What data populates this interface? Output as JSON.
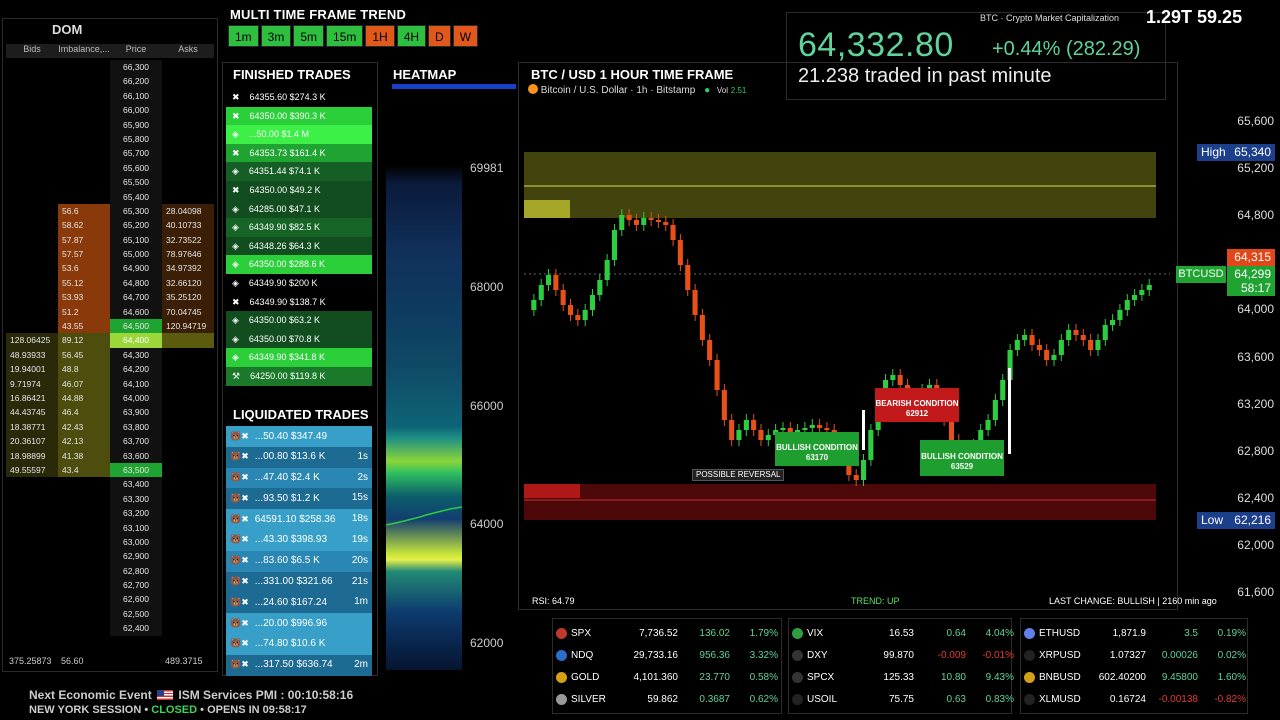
{
  "dom": {
    "title": "DOM",
    "headers": [
      "Bids",
      "Imbalance,...",
      "Price",
      "Asks"
    ],
    "rows": [
      [
        "",
        "",
        "66,300",
        ""
      ],
      [
        "",
        "",
        "66,200",
        ""
      ],
      [
        "",
        "",
        "66,100",
        ""
      ],
      [
        "",
        "",
        "66,000",
        ""
      ],
      [
        "",
        "",
        "65,900",
        ""
      ],
      [
        "",
        "",
        "65,800",
        ""
      ],
      [
        "",
        "",
        "65,700",
        ""
      ],
      [
        "",
        "",
        "65,600",
        ""
      ],
      [
        "",
        "",
        "65,500",
        ""
      ],
      [
        "",
        "",
        "65,400",
        ""
      ],
      [
        "",
        "56.6",
        "65,300",
        "28.04098"
      ],
      [
        "",
        "58.62",
        "65,200",
        "40.10733"
      ],
      [
        "",
        "57.87",
        "65,100",
        "32.73522"
      ],
      [
        "",
        "57.57",
        "65,000",
        "78.97646"
      ],
      [
        "",
        "53.6",
        "64,900",
        "34.97392"
      ],
      [
        "",
        "55.12",
        "64,800",
        "32.66120"
      ],
      [
        "",
        "53.93",
        "64,700",
        "35.25120"
      ],
      [
        "",
        "51.2",
        "64,600",
        "70.04745"
      ],
      [
        "",
        "43.55",
        "64,500",
        "120.94719"
      ],
      [
        "128.06425",
        "89.12",
        "64,400",
        ""
      ],
      [
        "48.93933",
        "56.45",
        "64,300",
        ""
      ],
      [
        "19.94001",
        "48.8",
        "64,200",
        ""
      ],
      [
        "9.71974",
        "46.07",
        "64,100",
        ""
      ],
      [
        "16.86421",
        "44.88",
        "64,000",
        ""
      ],
      [
        "44.43745",
        "46.4",
        "63,900",
        ""
      ],
      [
        "18.38771",
        "42.43",
        "63,800",
        ""
      ],
      [
        "20.36107",
        "42.13",
        "63,700",
        ""
      ],
      [
        "18.98899",
        "41.38",
        "63,600",
        ""
      ],
      [
        "49.55597",
        "43.4",
        "63,500",
        ""
      ],
      [
        "",
        "",
        "63,400",
        ""
      ],
      [
        "",
        "",
        "63,300",
        ""
      ],
      [
        "",
        "",
        "63,200",
        ""
      ],
      [
        "",
        "",
        "63,100",
        ""
      ],
      [
        "",
        "",
        "63,000",
        ""
      ],
      [
        "",
        "",
        "62,900",
        ""
      ],
      [
        "",
        "",
        "62,800",
        ""
      ],
      [
        "",
        "",
        "62,700",
        ""
      ],
      [
        "",
        "",
        "62,600",
        ""
      ],
      [
        "",
        "",
        "62,500",
        ""
      ],
      [
        "",
        "",
        "62,400",
        ""
      ]
    ],
    "footer": [
      "375.25873",
      "56.60",
      "",
      "489.3715"
    ]
  },
  "mtf": {
    "title": "MULTI TIME FRAME TREND",
    "frames": [
      {
        "label": "1m",
        "color": "#2fbf3f"
      },
      {
        "label": "3m",
        "color": "#2fbf3f"
      },
      {
        "label": "5m",
        "color": "#2fbf3f"
      },
      {
        "label": "15m",
        "color": "#2fbf3f"
      },
      {
        "label": "1H",
        "color": "#e0581a"
      },
      {
        "label": "4H",
        "color": "#2fbf3f"
      },
      {
        "label": "D",
        "color": "#e0581a"
      },
      {
        "label": "W",
        "color": "#e0581a"
      }
    ]
  },
  "finished": {
    "title": "FINISHED TRADES",
    "rows": [
      {
        "icon": "✖",
        "text": "64355.60 $274.3 K",
        "bg": "#000"
      },
      {
        "icon": "✖",
        "text": "64350.00 $390.3 K",
        "bg": "#2bcf3a"
      },
      {
        "icon": "◈",
        "text": "...50.00 $1.4 M",
        "bg": "#3df048"
      },
      {
        "icon": "✖",
        "text": "64353.73 $161.4 K",
        "bg": "#1fa331"
      },
      {
        "icon": "◈",
        "text": "64351.44 $74.1 K",
        "bg": "#155e26"
      },
      {
        "icon": "✖",
        "text": "64350.00 $49.2 K",
        "bg": "#124d20"
      },
      {
        "icon": "◈",
        "text": "64285.00 $47.1 K",
        "bg": "#124d20"
      },
      {
        "icon": "◈",
        "text": "64349.90 $82.5 K",
        "bg": "#166426"
      },
      {
        "icon": "◈",
        "text": "64348.26 $64.3 K",
        "bg": "#124d20"
      },
      {
        "icon": "◈",
        "text": "64350.00 $288.6 K",
        "bg": "#2bcf3a"
      },
      {
        "icon": "◈",
        "text": "64349.90 $200 K",
        "bg": "#000"
      },
      {
        "icon": "✖",
        "text": "64349.90 $138.7 K",
        "bg": "#000"
      },
      {
        "icon": "◈",
        "text": "64350.00 $63.2 K",
        "bg": "#124d20"
      },
      {
        "icon": "◈",
        "text": "64350.00 $70.8 K",
        "bg": "#124d20"
      },
      {
        "icon": "◈",
        "text": "64349.90 $341.8 K",
        "bg": "#2bcf3a"
      },
      {
        "icon": "⚒",
        "text": "64250.00 $119.8 K",
        "bg": "#1a7a2a"
      }
    ]
  },
  "liquidated": {
    "title": "LIQUIDATED TRADES",
    "rows": [
      {
        "text": "...50.40 $347.49",
        "time": ""
      },
      {
        "text": "...00.80 $13.6 K",
        "time": "1s"
      },
      {
        "text": "...47.40 $2.4 K",
        "time": "2s"
      },
      {
        "text": "...93.50 $1.2 K",
        "time": "15s"
      },
      {
        "text": "64591.10 $258.36",
        "time": "18s"
      },
      {
        "text": "...43.30 $398.93",
        "time": "19s"
      },
      {
        "text": "...83.60 $6.5 K",
        "time": "20s"
      },
      {
        "text": "...331.00 $321.66",
        "time": "21s"
      },
      {
        "text": "...24.60 $167.24",
        "time": "1m"
      },
      {
        "text": "...20.00 $996.96",
        "time": ""
      },
      {
        "text": "...74.80 $10.6 K",
        "time": ""
      },
      {
        "text": "...317.50 $636.74",
        "time": "2m"
      }
    ]
  },
  "heatmap": {
    "title": "HEATMAP",
    "ticks": [
      "69981",
      "68000",
      "66000",
      "64000",
      "62000"
    ]
  },
  "chart": {
    "title": "BTC / USD 1 HOUR TIME FRAME",
    "subtitle": "Bitcoin / U.S. Dollar · 1h · Bitstamp",
    "vol_label": "Vol",
    "vol_value": "2.51",
    "y_ticks": [
      "65,600",
      "65,200",
      "64,800",
      "64,000",
      "63,600",
      "63,200",
      "62,800",
      "62,400",
      "62,000",
      "61,600"
    ],
    "high_label": "High",
    "high_value": "65,340",
    "low_label": "Low",
    "low_value": "62,216",
    "price_tag": "64,315",
    "symbol_tag": "BTCUSD",
    "symbol_price": "64,299",
    "countdown": "58:17",
    "annotations": [
      {
        "label": "BULLISH CONDITION",
        "value": "63170"
      },
      {
        "label": "BEARISH CONDITION",
        "value": "62912"
      },
      {
        "label": "BULLISH CONDITION",
        "value": "63529"
      },
      {
        "label": "POSSIBLE REVERSAL",
        "value": ""
      }
    ]
  },
  "header": {
    "price": "64,332.80",
    "change": "+0.44% (282.29)",
    "volume": "21.238 traded in past minute",
    "mc_label": "BTC · Crypto Market Capitalization",
    "mc_values": "1.29T 59.25"
  },
  "footer_info": {
    "rsi": "RSI: 64.79",
    "trend": "TREND: UP",
    "last_change": "LAST CHANGE: BULLISH | 2160 min ago"
  },
  "tables": [
    [
      {
        "sym": "SPX",
        "color": "#c0392b",
        "v1": "7,736.52",
        "v2": "136.02",
        "v3": "1.79%"
      },
      {
        "sym": "NDQ",
        "color": "#2a6fc9",
        "v1": "29,733.16",
        "v2": "956.36",
        "v3": "3.32%"
      },
      {
        "sym": "GOLD",
        "color": "#d4a017",
        "v1": "4,101.360",
        "v2": "23.770",
        "v3": "0.58%"
      },
      {
        "sym": "SILVER",
        "color": "#999",
        "v1": "59.862",
        "v2": "0.3687",
        "v3": "0.62%"
      }
    ],
    [
      {
        "sym": "VIX",
        "color": "#2e9e3e",
        "v1": "16.53",
        "v2": "0.64",
        "v3": "4.04%"
      },
      {
        "sym": "DXY",
        "color": "#333",
        "v1": "99.870",
        "v2": "-0.009",
        "v3": "-0.01%"
      },
      {
        "sym": "SPCX",
        "color": "#333",
        "v1": "125.33",
        "v2": "10.80",
        "v3": "9.43%"
      },
      {
        "sym": "USOIL",
        "color": "#222",
        "v1": "75.75",
        "v2": "0.63",
        "v3": "0.83%"
      }
    ],
    [
      {
        "sym": "ETHUSD",
        "color": "#627eea",
        "v1": "1,871.9",
        "v2": "3.5",
        "v3": "0.19%"
      },
      {
        "sym": "XRPUSD",
        "color": "#222",
        "v1": "1.07327",
        "v2": "0.00026",
        "v3": "0.02%"
      },
      {
        "sym": "BNBUSD",
        "color": "#d4a017",
        "v1": "602.40200",
        "v2": "9.45800",
        "v3": "1.60%"
      },
      {
        "sym": "XLMUSD",
        "color": "#222",
        "v1": "0.16724",
        "v2": "-0.00138",
        "v3": "-0.82%"
      }
    ]
  ],
  "econ": {
    "label": "Next Economic Event",
    "event": "ISM Services PMI : 00:10:58:16",
    "session": "NEW YORK SESSION",
    "dot": "•",
    "status": "CLOSED",
    "opens": "• OPENS IN 09:58:17"
  }
}
